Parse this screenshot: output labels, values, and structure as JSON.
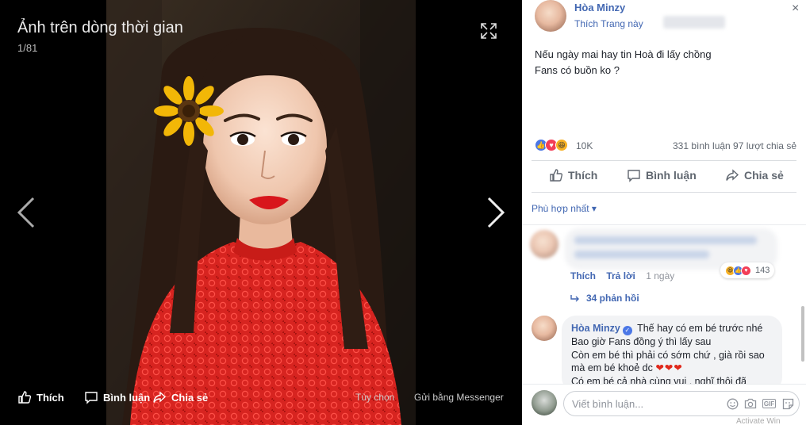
{
  "theater": {
    "title": "Ảnh trên dòng thời gian",
    "counter": "1/81",
    "footer": {
      "like": "Thích",
      "comment": "Bình luận",
      "share": "Chia sẻ",
      "options": "Tùy chọn",
      "send": "Gửi bằng Messenger"
    }
  },
  "post": {
    "author": "Hòa Minzy",
    "like_page": "Thích Trang này",
    "close": "×",
    "text_lines": [
      "Nếu ngày mai hay tin Hoà đi lấy chồng",
      "Fans có buồn ko ?"
    ],
    "reaction_count": "10K",
    "stats": "331 bình luận  97 lượt chia sẻ",
    "actions": {
      "like": "Thích",
      "comment": "Bình luận",
      "share": "Chia sẻ"
    },
    "sort": "Phù hợp nhất ▾"
  },
  "comments": {
    "first": {
      "reaction_count": "143",
      "like": "Thích",
      "reply": "Trả lời",
      "time": "1 ngày",
      "replies": "34 phản hồi"
    },
    "second": {
      "author": "Hòa Minzy",
      "line1": "Thế hay có em bé trước nhé",
      "line2": "Bao giờ Fans đồng ý thì lấy sau",
      "line3": "Còn em bé thì phải có sớm chứ , già rồi sao",
      "line4": "mà em bé khoẻ dc",
      "hearts": "❤❤❤",
      "line5": "Có em bé cả nhà cùng vui , nghĩ thôi đã"
    }
  },
  "composer": {
    "placeholder": "Viết bình luận..."
  },
  "watermark": "Activate Win",
  "colors": {
    "link": "#4267b2",
    "text": "#1d2129",
    "muted": "#606770",
    "dress": "#d9231f"
  }
}
